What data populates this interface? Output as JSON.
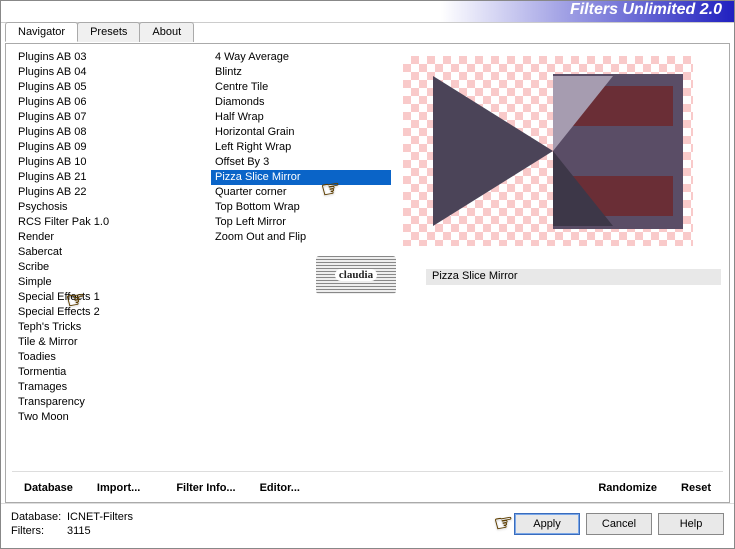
{
  "header": {
    "title": "Filters Unlimited 2.0"
  },
  "tabs": {
    "navigator": "Navigator",
    "presets": "Presets",
    "about": "About"
  },
  "categories": {
    "items": [
      "Plugins AB 03",
      "Plugins AB 04",
      "Plugins AB 05",
      "Plugins AB 06",
      "Plugins AB 07",
      "Plugins AB 08",
      "Plugins AB 09",
      "Plugins AB 10",
      "Plugins AB 21",
      "Plugins AB 22",
      "Psychosis",
      "RCS Filter Pak 1.0",
      "Render",
      "Sabercat",
      "Scribe",
      "Simple",
      "Special Effects 1",
      "Special Effects 2",
      "Teph's Tricks",
      "Tile & Mirror",
      "Toadies",
      "Tormentia",
      "Tramages",
      "Transparency",
      "Two Moon"
    ],
    "selected": "Simple"
  },
  "filters": {
    "items": [
      "4 Way Average",
      "Blintz",
      "Centre Tile",
      "Diamonds",
      "Half Wrap",
      "Horizontal Grain",
      "Left Right Wrap",
      "Offset By 3",
      "Pizza Slice Mirror",
      "Quarter corner",
      "Top Bottom Wrap",
      "Top Left Mirror",
      "Zoom Out and Flip"
    ],
    "selected": "Pizza Slice Mirror"
  },
  "filter_name": "Pizza Slice Mirror",
  "logo_text": "claudia",
  "buttons": {
    "database": "Database",
    "import": "Import...",
    "filter_info": "Filter Info...",
    "editor": "Editor...",
    "randomize": "Randomize",
    "reset": "Reset",
    "apply": "Apply",
    "cancel": "Cancel",
    "help": "Help"
  },
  "status": {
    "db_label": "Database:",
    "db_value": "ICNET-Filters",
    "filters_label": "Filters:",
    "filters_value": "3115"
  }
}
